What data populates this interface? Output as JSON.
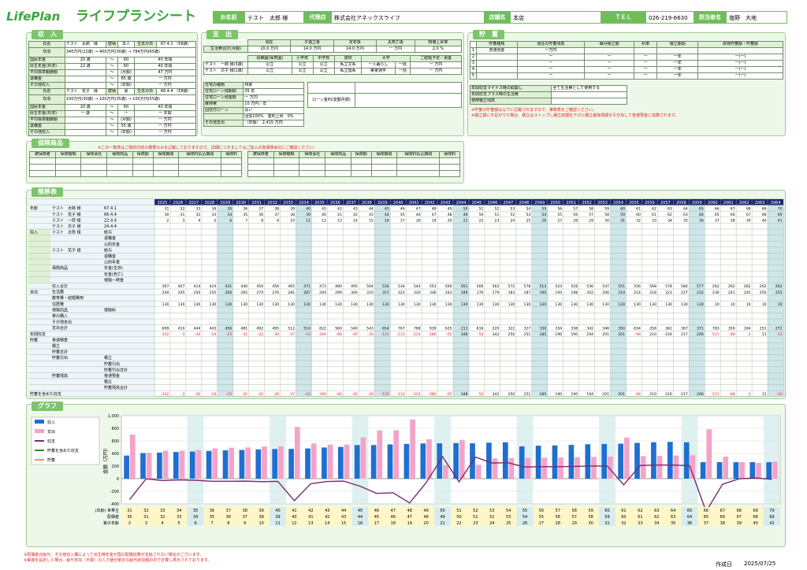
{
  "header": {
    "logo": "LifePlan",
    "title": "ライフプランシート",
    "name_label": "お名前",
    "name_value": "テスト　太郎 様",
    "agency_label": "代理店",
    "agency_value": "株式会社アネックスライフ",
    "store_label": "店舗名",
    "store_value": "本店",
    "tel_label": "ＴＥＬ",
    "tel_value": "026-219-6630",
    "person_label": "担当者名",
    "person_value": "塩野　大地"
  },
  "income": {
    "title": "収　入",
    "p1": {
      "name_label": "氏名",
      "name": "テスト　太郎　様",
      "rel": "続柄",
      "rel_v": "本人",
      "birth_label": "生年月日",
      "birth": "67.4.1",
      "age": "（58歳）",
      "nenshu": "年収",
      "nenshu_line": "340万円(22歳) → 400万円(30歳) → 784万円(65歳)",
      "rows": [
        [
          "国民年金",
          "20 歳",
          "60",
          "40 年間"
        ],
        [
          "厚生年金(共済)",
          "22 歳",
          "60",
          "40 年間"
        ],
        [
          "平均標準報酬額",
          "",
          "(月額)",
          "47 万円"
        ],
        [
          "退職金",
          "",
          "65 歳",
          "一 万円"
        ],
        [
          "その他収入",
          "",
          "(年額)",
          "一 万円"
        ]
      ]
    },
    "p2": {
      "name_label": "氏名",
      "name": "テスト　花子　様",
      "rel": "続柄",
      "rel_v": "妻",
      "birth_label": "生年月日",
      "birth": "66.4.4",
      "age": "（58歳）",
      "nenshu": "年収",
      "nenshu_line": "100万円(30歳) → 100万円(35歳) → 100万円(55歳)",
      "rows": [
        [
          "国民年金",
          "20 歳",
          "60",
          "40 年間"
        ],
        [
          "厚生年金(共済)",
          "一 歳",
          "一",
          "一 年間"
        ],
        [
          "平均標準報酬額",
          "",
          "(月額)",
          "一 万円"
        ],
        [
          "退職金",
          "",
          "55 歳",
          "一 万円"
        ],
        [
          "その他収入",
          "",
          "(年額)",
          "一 万円"
        ]
      ]
    }
  },
  "expense": {
    "title": "支　出",
    "heads": [
      "現在",
      "子独立後",
      "定年後",
      "夫死亡後",
      "物価上昇率"
    ],
    "living_label": "生活費合計(月額)",
    "living_vals": [
      "20.0 万円",
      "14.0 万円",
      "14.0 万円",
      "一 万円",
      "2.0 %"
    ],
    "edu_heads": [
      "幼稚園(保育園)",
      "小学校",
      "中学校",
      "高校",
      "大学",
      "ご結婚予定／資金"
    ],
    "edu_rows": [
      [
        "テスト　一郎 様(3歳)",
        "公立",
        "公立",
        "公立",
        "私立文系",
        "一人暮らし",
        "一括",
        "一 万円"
      ],
      [
        "テスト　次子 様(1歳)",
        "公立",
        "公立",
        "公立",
        "私立理系",
        "実家通学",
        "一括",
        "一 万円"
      ]
    ],
    "housing": [
      [
        "住宅の種類",
        "持家"
      ],
      [
        "住宅ローン残期間",
        "35 年"
      ],
      [
        "住宅ローン残金額",
        "一 万円"
      ],
      [
        "維持費",
        "10 万円／年"
      ],
      [
        "団信付ローン",
        "はい"
      ],
      [
        "",
        "団信100%　金利上昇　0%"
      ],
      [
        "その他支出",
        "（年額）　2,415 万円"
      ]
    ],
    "loan_label": "ローン金利(変動月額)"
  },
  "savings": {
    "title": "貯　蓄",
    "heads": [
      "貯蓄種類",
      "現在の貯蓄残高",
      "毎月積立額",
      "利率",
      "積立期間",
      "目標貯蓄額・貯蓄額"
    ],
    "rows": [
      [
        "1",
        "普通預金",
        "一万円",
        "",
        "",
        "",
        ""
      ],
      [
        "2",
        "",
        "一",
        "一",
        "一",
        "一年",
        "一(一)"
      ],
      [
        "3",
        "",
        "一",
        "一",
        "一",
        "一年",
        "一(一)"
      ],
      [
        "4",
        "",
        "一",
        "一",
        "一",
        "一年",
        "一(一)"
      ],
      [
        "5",
        "",
        "一",
        "一",
        "一",
        "一年",
        "一(一)"
      ]
    ],
    "notes": [
      [
        "年間収支マイナス時の取崩し",
        "全て生活費として使用する"
      ],
      [
        "年間収支プラス時の生活費",
        ""
      ],
      [
        "使用積立残高",
        ""
      ]
    ],
    "warn1": "※貯蓄の貯蓄額は以下に記載されますので、推移表をご確認ください。",
    "warn2": "※積立額に不足がでた場合、積立はストップし積立総額を下げに積立最後残額を引き出して普通預金に加算されます。"
  },
  "insurance": {
    "title": "保険商品",
    "note": "※この一覧表はご契約内容の概要のみを記載しておりますので、詳細につきましてはご加入の各保険会社にご確認ください。",
    "heads": [
      "被保険者",
      "保険種類",
      "保険会社",
      "保険商品",
      "保険額",
      "保険期間",
      "保険料払込期間",
      "保険料"
    ]
  },
  "table": {
    "title": "推移表",
    "years": [
      "2025",
      "2026",
      "2027",
      "2028",
      "2029",
      "2030",
      "2031",
      "2032",
      "2033",
      "2034",
      "2035",
      "2036",
      "2037",
      "2038",
      "2039",
      "2040",
      "2041",
      "2042",
      "2043",
      "2044",
      "2045",
      "2046",
      "2047",
      "2048",
      "2049",
      "2050",
      "2051",
      "2052",
      "2053",
      "2054",
      "2055",
      "2056",
      "2057",
      "2058",
      "2059",
      "2060",
      "2061",
      "2062",
      "2063",
      "2064"
    ],
    "row_labels": [
      [
        "年齢",
        "テスト　太郎 様",
        "67.4.1"
      ],
      [
        "",
        "テスト　花子 様",
        "66.4.4"
      ],
      [
        "",
        "テスト　一郎 様",
        "22.4.4"
      ],
      [
        "",
        "テスト　次子 様",
        "24.4.4"
      ],
      [
        "収入",
        "テスト　太郎 様",
        "給与"
      ],
      [
        "",
        "",
        "退職金"
      ],
      [
        "",
        "",
        "公的年金"
      ],
      [
        "",
        "テスト　花子 様",
        "給与"
      ],
      [
        "",
        "",
        "退職金"
      ],
      [
        "",
        "",
        "公的年金"
      ],
      [
        "",
        "保険商品",
        "年金(生存) "
      ],
      [
        "",
        "",
        "年金(死亡)"
      ],
      [
        "",
        "",
        "保険一時金"
      ],
      [
        "",
        "収入合計",
        ""
      ],
      [
        "支出",
        "生活費",
        ""
      ],
      [
        "",
        "教育費・結婚費用",
        ""
      ],
      [
        "",
        "住居費",
        ""
      ],
      [
        "",
        "保険商品",
        "保険料"
      ],
      [
        "",
        "車の購入",
        ""
      ],
      [
        "",
        "その他支出",
        ""
      ],
      [
        "",
        "支出合計",
        ""
      ],
      [
        "年間収支",
        "",
        ""
      ],
      [
        "貯蓄",
        "普通預金",
        ""
      ],
      [
        "",
        "積立",
        ""
      ],
      [
        "",
        "貯蓄合計",
        ""
      ],
      [
        "",
        "貯蓄引出",
        "積立"
      ],
      [
        "",
        "",
        "貯蓄引出"
      ],
      [
        "",
        "",
        "貯蓄引出合計"
      ],
      [
        "",
        "貯蓄残高",
        "普通預金"
      ],
      [
        "",
        "",
        "積立"
      ],
      [
        "",
        "",
        "貯蓄残高合計"
      ],
      [
        "貯蓄を含めた収支",
        "",
        ""
      ]
    ],
    "age1": [
      31,
      32,
      33,
      34,
      35,
      36,
      37,
      38,
      39,
      40,
      41,
      42,
      43,
      44,
      45,
      46,
      47,
      48,
      49,
      50,
      51,
      52,
      53,
      54,
      55,
      56,
      57,
      58,
      59,
      60,
      61,
      62,
      63,
      64,
      65,
      66,
      67,
      68,
      69,
      70
    ],
    "age2": [
      30,
      31,
      32,
      33,
      34,
      35,
      36,
      37,
      38,
      39,
      40,
      41,
      42,
      43,
      44,
      45,
      46,
      47,
      48,
      49,
      50,
      51,
      52,
      53,
      54,
      55,
      56,
      57,
      58,
      59,
      60,
      61,
      62,
      63,
      64,
      65,
      66,
      67,
      68,
      69
    ],
    "age3": [
      2,
      3,
      4,
      5,
      6,
      7,
      8,
      9,
      10,
      11,
      12,
      13,
      14,
      15,
      16,
      17,
      18,
      19,
      20,
      21,
      22,
      23,
      24,
      25,
      26,
      27,
      28,
      29,
      30,
      31,
      32,
      33,
      34,
      35,
      36,
      37,
      38,
      39,
      40,
      41
    ],
    "income_total": [
      367,
      407,
      414,
      424,
      431,
      440,
      450,
      456,
      465,
      471,
      473,
      480,
      495,
      504,
      534,
      534,
      544,
      553,
      560,
      561,
      566,
      562,
      572,
      578,
      513,
      524,
      528,
      536,
      547,
      551,
      556,
      568,
      578,
      584,
      577,
      262,
      262,
      262,
      262,
      262
    ],
    "living": [
      240,
      245,
      250,
      255,
      260,
      265,
      270,
      276,
      281,
      287,
      293,
      299,
      304,
      310,
      317,
      323,
      330,
      336,
      343,
      349,
      176,
      179,
      183,
      187,
      190,
      194,
      198,
      202,
      206,
      210,
      214,
      218,
      223,
      227,
      232,
      236,
      241,
      245,
      250,
      255
    ],
    "housing": [
      130,
      130,
      130,
      130,
      130,
      130,
      130,
      130,
      130,
      130,
      130,
      130,
      130,
      130,
      130,
      130,
      130,
      130,
      130,
      130,
      130,
      130,
      130,
      130,
      130,
      130,
      130,
      130,
      130,
      130,
      130,
      130,
      130,
      130,
      130,
      10,
      10,
      10,
      10,
      10
    ],
    "expense_total": [
      699,
      410,
      444,
      443,
      456,
      481,
      492,
      495,
      512,
      514,
      822,
      560,
      540,
      543,
      654,
      767,
      768,
      939,
      625,
      213,
      616,
      220,
      322,
      327,
      330,
      334,
      338,
      342,
      346,
      350,
      654,
      358,
      362,
      367,
      371,
      783,
      350,
      264,
      251,
      272
    ],
    "balance": [
      -332,
      -3,
      -30,
      -19,
      -25,
      -41,
      -42,
      -39,
      -47,
      -43,
      -349,
      -80,
      -45,
      -39,
      -120,
      -233,
      -224,
      -386,
      -65,
      348,
      -50,
      342,
      250,
      251,
      185,
      190,
      190,
      194,
      201,
      201,
      -98,
      210,
      216,
      217,
      206,
      -521,
      -88,
      -2,
      11,
      -10
    ]
  },
  "graph": {
    "title": "グラフ",
    "legend": [
      "収入",
      "支出",
      "収支",
      "貯蓄を含めた収支",
      "貯蓄"
    ],
    "ylabel": "金額（万円）",
    "yticks": [
      "1,000",
      "800",
      "600",
      "400",
      "200",
      "0",
      "-200",
      "-400"
    ],
    "row_labels": [
      "(年齢) 世帯主",
      "配偶者",
      "第子年齢"
    ],
    "colors": {
      "income": "#1f6fd1",
      "expense": "#f4a3c8",
      "balance": "#7a2a6a",
      "with_savings": "#2e8b2e",
      "savings": "#f0a030"
    }
  },
  "footer": {
    "note1": "※配偶者の給与、その他収入欄によって出生時年金が国の配偶加算が支給されない場合がございます。",
    "note2": "※実施を設定した場合、給与年収（手取）の入力値が家計の給与総収額の中で計算し表示されております。",
    "date_label": "作成日",
    "date": "2025/07/25"
  }
}
